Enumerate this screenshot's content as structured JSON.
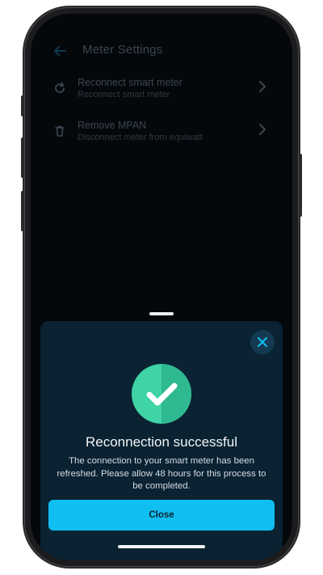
{
  "header": {
    "title": "Meter Settings",
    "back_icon": "arrow-left-icon"
  },
  "settings": {
    "items": [
      {
        "icon": "refresh-icon",
        "title": "Reconnect smart meter",
        "subtitle": "Reconnect smart meter"
      },
      {
        "icon": "trash-icon",
        "title": "Remove MPAN",
        "subtitle": "Disconnect meter from equiwatt"
      }
    ]
  },
  "modal": {
    "close_icon": "close-icon",
    "status_icon": "check-circle-icon",
    "title": "Reconnection successful",
    "message": "The connection to your smart meter has been refreshed. Please allow 48 hours for this process to be completed.",
    "button_label": "Close"
  },
  "colors": {
    "accent": "#10bff2",
    "success": "#3fd3a6",
    "sheet_background": "#0a2232",
    "screen_background": "#05080b"
  }
}
